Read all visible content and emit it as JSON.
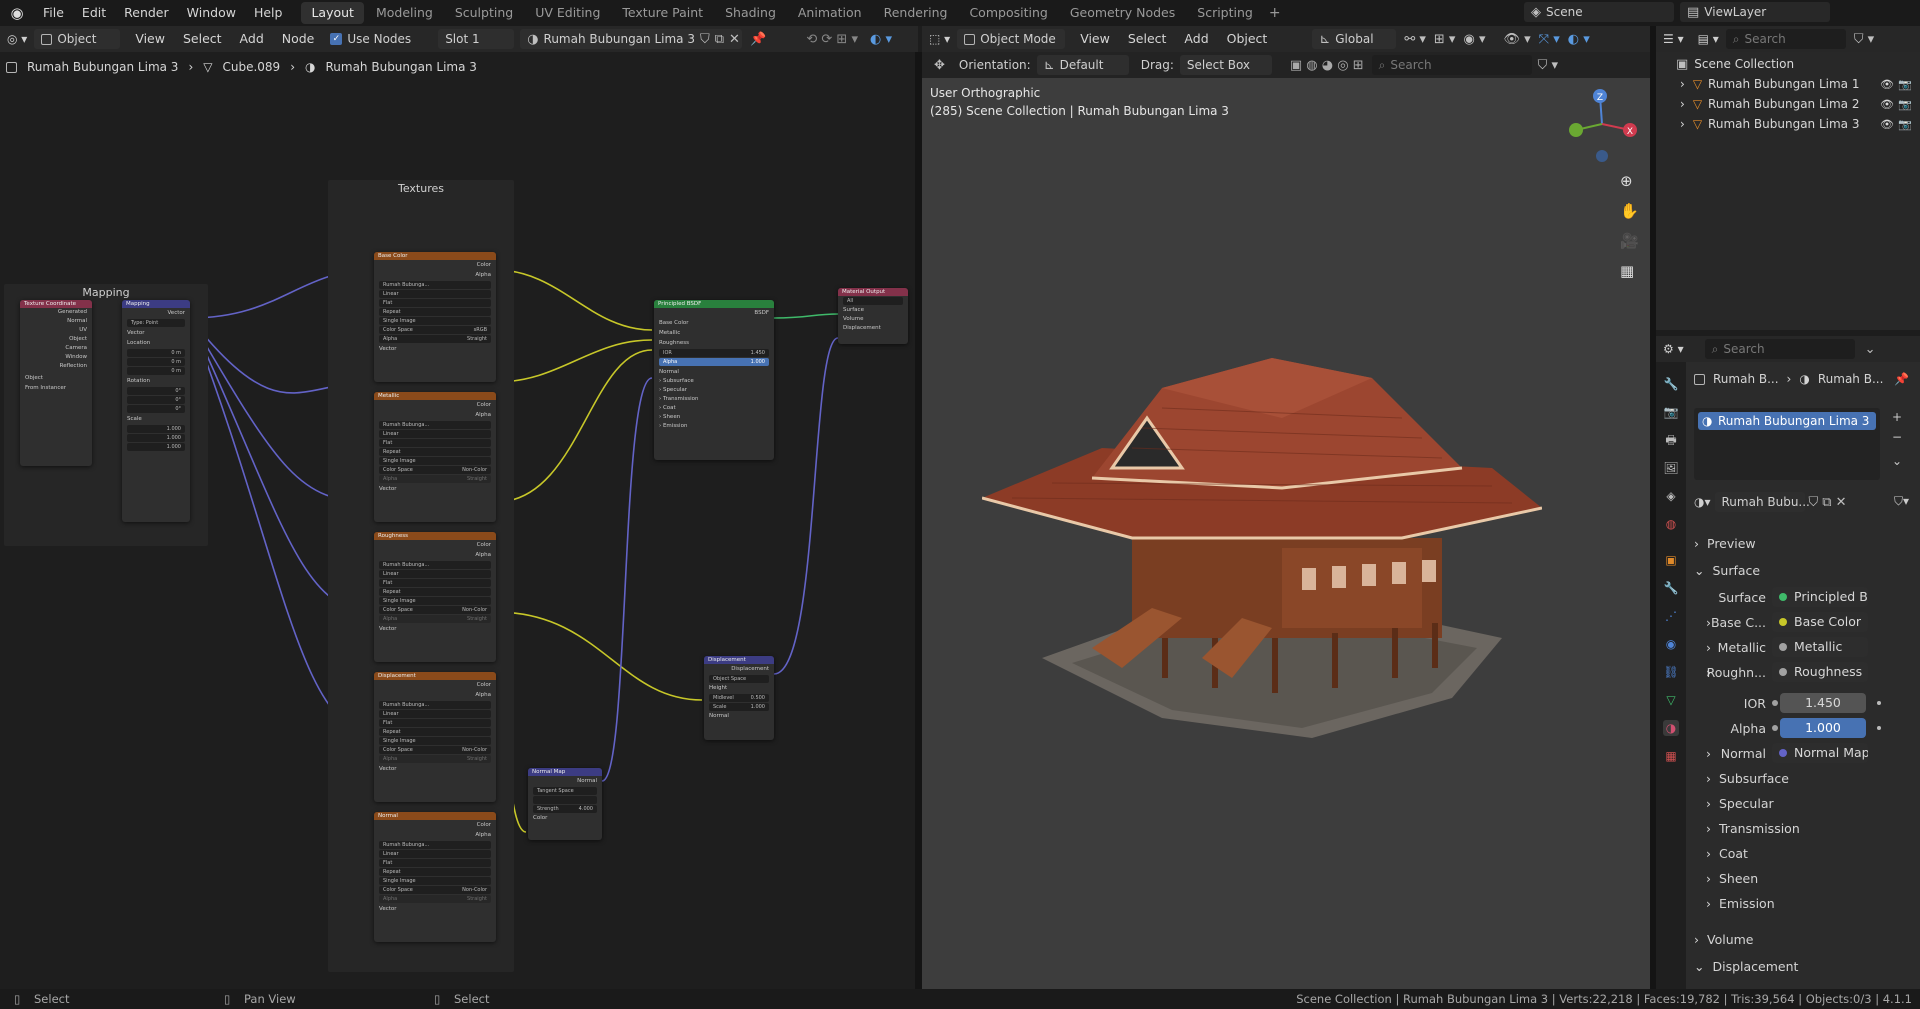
{
  "top_menu": [
    "File",
    "Edit",
    "Render",
    "Window",
    "Help"
  ],
  "workspace_tabs": [
    "Layout",
    "Modeling",
    "Sculpting",
    "UV Editing",
    "Texture Paint",
    "Shading",
    "Animation",
    "Rendering",
    "Compositing",
    "Geometry Nodes",
    "Scripting"
  ],
  "active_workspace": "Layout",
  "scene": {
    "label": "Scene",
    "viewlayer": "ViewLayer"
  },
  "node_editor": {
    "header": {
      "mode": "Object",
      "menus": [
        "View",
        "Select",
        "Add",
        "Node"
      ],
      "use_nodes": "Use Nodes",
      "slot": "Slot 1",
      "material": "Rumah Bubungan Lima 3"
    },
    "breadcrumb": [
      "Rumah Bubungan Lima 3",
      "Cube.089",
      "Rumah Bubungan Lima 3"
    ],
    "frames": {
      "textures": "Textures",
      "mapping": "Mapping"
    },
    "tex_coord": {
      "title": "Texture Coordinate",
      "outputs": [
        "Generated",
        "Normal",
        "UV",
        "Object",
        "Camera",
        "Window",
        "Reflection"
      ],
      "object_label": "Object",
      "from_instancer": "From Instancer"
    },
    "mapping": {
      "title": "Mapping",
      "out": "Vector",
      "type_label": "Type",
      "type": "Point",
      "vector": "Vector",
      "location": "Location",
      "rotation": "Rotation",
      "scale": "Scale",
      "loc": [
        "0 m",
        "0 m",
        "0 m"
      ],
      "rot": [
        "0°",
        "0°",
        "0°"
      ],
      "scl": [
        "1.000",
        "1.000",
        "1.000"
      ],
      "axes": [
        "X",
        "Y",
        "Z"
      ]
    },
    "tex_nodes": [
      {
        "title": "Base Color",
        "color_space": "sRGB"
      },
      {
        "title": "Metallic",
        "color_space": "Non-Color"
      },
      {
        "title": "Roughness",
        "color_space": "Non-Color"
      },
      {
        "title": "Displacement",
        "color_space": "Non-Color"
      },
      {
        "title": "Normal",
        "color_space": "Non-Color"
      }
    ],
    "tex_common": {
      "color": "Color",
      "alpha": "Alpha",
      "image": "Rumah Bubunga...",
      "interp": "Linear",
      "proj": "Flat",
      "ext": "Repeat",
      "src": "Single Image",
      "cs_label": "Color Space",
      "alpha_label": "Alpha",
      "alpha_mode": "Straight",
      "vector": "Vector"
    },
    "bsdf": {
      "title": "Principled BSDF",
      "out": "BSDF",
      "inputs": [
        "Base Color",
        "Metallic",
        "Roughness"
      ],
      "ior_label": "IOR",
      "ior": "1.450",
      "alpha_label": "Alpha",
      "alpha": "1.000",
      "normal": "Normal",
      "panels": [
        "Subsurface",
        "Specular",
        "Transmission",
        "Coat",
        "Sheen",
        "Emission"
      ]
    },
    "output": {
      "title": "Material Output",
      "target": "All",
      "inputs": [
        "Surface",
        "Volume",
        "Displacement"
      ]
    },
    "disp": {
      "title": "Displacement",
      "out": "Displacement",
      "space": "Object Space",
      "height": "Height",
      "midlevel_label": "Midlevel",
      "midlevel": "0.500",
      "scale_label": "Scale",
      "scale": "1.000",
      "normal": "Normal"
    },
    "normal_map": {
      "title": "Normal Map",
      "out": "Normal",
      "space": "Tangent Space",
      "strength_label": "Strength",
      "strength": "4.000",
      "color": "Color"
    }
  },
  "viewport": {
    "header": {
      "mode": "Object Mode",
      "menus": [
        "View",
        "Select",
        "Add",
        "Object"
      ],
      "transform": "Global",
      "search": "Search"
    },
    "tool_header": {
      "orientation_label": "Orientation:",
      "orientation": "Default",
      "drag_label": "Drag:",
      "drag": "Select Box"
    },
    "overlay_title": "User Orthographic",
    "overlay_sub": "(285) Scene Collection | Rumah Bubungan Lima 3",
    "gizmo": {
      "x": "X",
      "y": "Y",
      "z": "Z"
    }
  },
  "outliner": {
    "search": "Search",
    "collection": "Scene Collection",
    "items": [
      "Rumah Bubungan Lima 1",
      "Rumah Bubungan Lima 2",
      "Rumah Bubungan Lima 3"
    ]
  },
  "properties": {
    "search": "Search",
    "breadcrumb": [
      "Rumah B...",
      "Rumah B..."
    ],
    "slot": "Rumah Bubungan Lima 3",
    "material_name": "Rumah Bubu...",
    "preview": "Preview",
    "surface_panel": "Surface",
    "rows": [
      {
        "label": "Surface",
        "value": "Principled BSDF",
        "color": "#3fba6a",
        "expand": false
      },
      {
        "label": "Base C...",
        "value": "Base Color",
        "color": "#c7c729",
        "expand": true
      },
      {
        "label": "Metallic",
        "value": "Metallic",
        "color": "#a1a1a1",
        "expand": true
      },
      {
        "label": "Roughn...",
        "value": "Roughness",
        "color": "#a1a1a1",
        "expand": true
      }
    ],
    "ior_label": "IOR",
    "ior": "1.450",
    "alpha_label": "Alpha",
    "alpha": "1.000",
    "normal_label": "Normal",
    "normal": "Normal Map",
    "subpanels": [
      "Subsurface",
      "Specular",
      "Transmission",
      "Coat",
      "Sheen",
      "Emission"
    ],
    "volume": "Volume",
    "displacement": "Displacement"
  },
  "status": {
    "left": [
      "Select",
      "Pan View",
      "Select"
    ],
    "right": "Scene Collection | Rumah Bubungan Lima 3 | Verts:22,218 | Faces:19,782 | Tris:39,564 | Objects:0/3 | 4.1.1"
  }
}
